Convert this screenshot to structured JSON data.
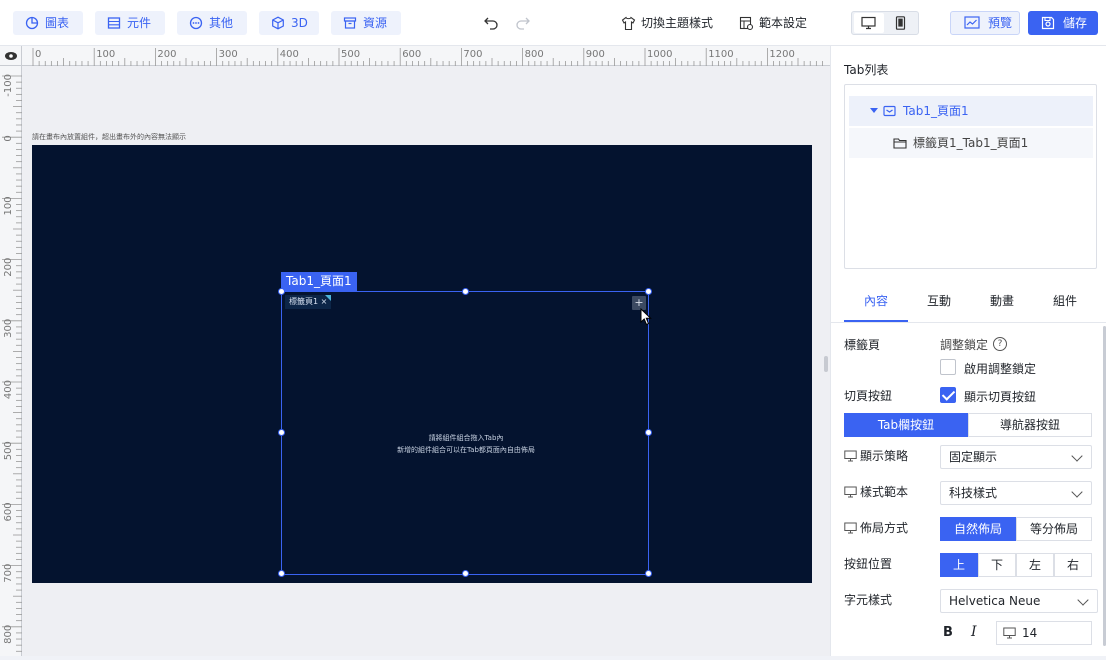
{
  "toolbar": {
    "chart_label": "圖表",
    "component_label": "元件",
    "other_label": "其他",
    "threed_label": "3D",
    "resource_label": "資源",
    "theme_label": "切換主題樣式",
    "template_label": "範本設定",
    "preview_label": "預覽",
    "save_label": "儲存"
  },
  "rulers": {
    "horizontal": [
      "0",
      "100",
      "200",
      "300",
      "400",
      "500",
      "600",
      "700",
      "800",
      "900",
      "1000",
      "1100",
      "1200"
    ],
    "vertical": [
      "-100",
      "0",
      "100",
      "200",
      "300",
      "400",
      "500",
      "600",
      "700",
      "800"
    ]
  },
  "canvas": {
    "hint": "請在畫布內放置組件，超出畫布外的內容無法顯示",
    "tab_component_label": "Tab1_頁面1",
    "inner_tab_label": "標籤頁1 ×",
    "add_tab_symbol": "+",
    "empty_line1": "請將組件組合拖入Tab內",
    "empty_line2": "新增的組件組合可以在Tab都頁面內自由佈局"
  },
  "right_panel": {
    "tablist_title": "Tab列表",
    "tree": {
      "root": "Tab1_頁面1",
      "child": "標籤頁1_Tab1_頁面1"
    },
    "tabs": [
      "內容",
      "互動",
      "動畫",
      "組件"
    ],
    "active_tab": "內容",
    "props": {
      "tabpage_label": "標籤頁",
      "adjust_lock_label": "調整鎖定",
      "enable_adjust_lock": "啟用調整鎖定",
      "enable_adjust_lock_checked": false,
      "page_button_label": "切頁按鈕",
      "show_page_button": "顯示切頁按鈕",
      "show_page_button_checked": true,
      "button_type_tab": "Tab欄按鈕",
      "button_type_nav": "導航器按鈕",
      "display_strategy_label": "顯示策略",
      "display_strategy_value": "固定顯示",
      "style_template_label": "樣式範本",
      "style_template_value": "科技樣式",
      "layout_label": "佈局方式",
      "layout_natural": "自然佈局",
      "layout_equal": "等分佈局",
      "position_label": "按鈕位置",
      "positions": [
        "上",
        "下",
        "左",
        "右"
      ],
      "font_style_label": "字元樣式",
      "font_family_value": "Helvetica Neue",
      "bold_label": "B",
      "italic_label": "I",
      "font_size_value": "14"
    }
  },
  "colors": {
    "accent": "#3a63f2",
    "stage_bg": "#04132f"
  }
}
